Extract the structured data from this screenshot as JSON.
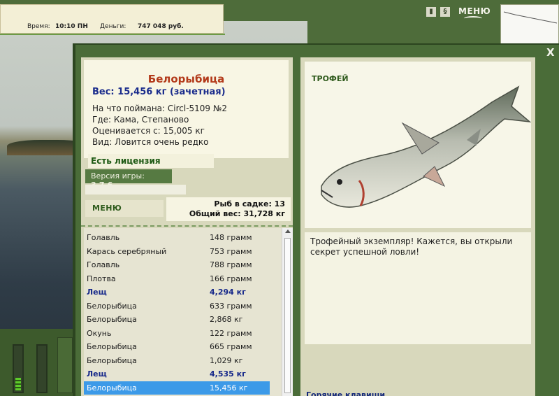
{
  "topbar": {
    "time_label": "Время:",
    "time_value": "10:10 ПН",
    "money_label": "Деньги:",
    "money_value": "747 048 руб."
  },
  "hud": {
    "pause_icon": "pause-icon",
    "sound_icon": "sound-icon",
    "menu_label": "МЕНЮ"
  },
  "fish": {
    "name": "Белорыбица",
    "weight": "Вес: 15,456 кг (зачетная)",
    "bait": "На что поймана: Circl-5109 №2",
    "location": "Где: Кама, Степаново",
    "rated_from": "Оценивается с: 15,005 кг",
    "kind": "Вид: Ловится очень редко"
  },
  "license": "Есть лицензия",
  "version": {
    "label": "Версия игры: ",
    "value": "3.7.6"
  },
  "left_menu": "МЕНЮ",
  "cage": {
    "count": "Рыб в садке: 13",
    "total": "Общий вес: 31,728 кг"
  },
  "catch_list": [
    {
      "name": "Голавль",
      "weight": "148 грамм",
      "big": false,
      "selected": false
    },
    {
      "name": "Карась серебряный",
      "weight": "753 грамм",
      "big": false,
      "selected": false
    },
    {
      "name": "Голавль",
      "weight": "788 грамм",
      "big": false,
      "selected": false
    },
    {
      "name": "Плотва",
      "weight": "166 грамм",
      "big": false,
      "selected": false
    },
    {
      "name": "Лещ",
      "weight": "4,294 кг",
      "big": true,
      "selected": false
    },
    {
      "name": "Белорыбица",
      "weight": "633 грамм",
      "big": false,
      "selected": false
    },
    {
      "name": "Белорыбица",
      "weight": "2,868 кг",
      "big": false,
      "selected": false
    },
    {
      "name": "Окунь",
      "weight": "122 грамм",
      "big": false,
      "selected": false
    },
    {
      "name": "Белорыбица",
      "weight": "665 грамм",
      "big": false,
      "selected": false
    },
    {
      "name": "Белорыбица",
      "weight": "1,029 кг",
      "big": false,
      "selected": false
    },
    {
      "name": "Лещ",
      "weight": "4,535 кг",
      "big": true,
      "selected": false
    },
    {
      "name": "Белорыбица",
      "weight": "15,456 кг",
      "big": false,
      "selected": true
    }
  ],
  "trophy": {
    "title": "ТРОФЕЙ",
    "text": "Трофейный экземпляр! Кажется, вы открыли секрет успешной ловли!",
    "hotkeys": "Горячие клавиши"
  },
  "close": "X",
  "colors": {
    "frame_green": "#4a6c38",
    "panel_beige": "#d8d8bc",
    "fish_name_red": "#b33a1a",
    "weight_blue": "#1a2c8c",
    "selection_blue": "#3c9ae8"
  }
}
